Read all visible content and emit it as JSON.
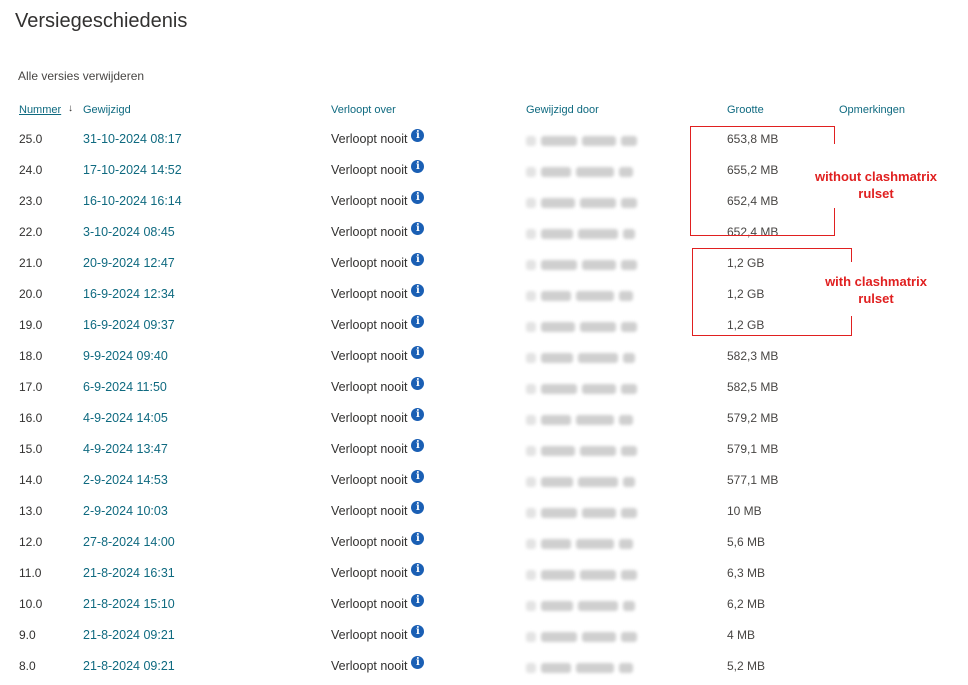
{
  "page": {
    "title": "Versiegeschiedenis",
    "delete_all": "Alle versies verwijderen"
  },
  "columns": {
    "number": "Nummer",
    "sort_indicator": "↓",
    "modified": "Gewijzigd",
    "expires": "Verloopt over",
    "modified_by": "Gewijzigd door",
    "size": "Grootte",
    "comments": "Opmerkingen"
  },
  "rows": [
    {
      "number": "25.0",
      "modified": "31-10-2024 08:17",
      "expires": "Verloopt nooit",
      "size": "653,8 MB"
    },
    {
      "number": "24.0",
      "modified": "17-10-2024 14:52",
      "expires": "Verloopt nooit",
      "size": "655,2 MB"
    },
    {
      "number": "23.0",
      "modified": "16-10-2024 16:14",
      "expires": "Verloopt nooit",
      "size": "652,4 MB"
    },
    {
      "number": "22.0",
      "modified": "3-10-2024 08:45",
      "expires": "Verloopt nooit",
      "size": "652,4 MB"
    },
    {
      "number": "21.0",
      "modified": "20-9-2024 12:47",
      "expires": "Verloopt nooit",
      "size": "1,2 GB"
    },
    {
      "number": "20.0",
      "modified": "16-9-2024 12:34",
      "expires": "Verloopt nooit",
      "size": "1,2 GB"
    },
    {
      "number": "19.0",
      "modified": "16-9-2024 09:37",
      "expires": "Verloopt nooit",
      "size": "1,2 GB"
    },
    {
      "number": "18.0",
      "modified": "9-9-2024 09:40",
      "expires": "Verloopt nooit",
      "size": "582,3 MB"
    },
    {
      "number": "17.0",
      "modified": "6-9-2024 11:50",
      "expires": "Verloopt nooit",
      "size": "582,5 MB"
    },
    {
      "number": "16.0",
      "modified": "4-9-2024 14:05",
      "expires": "Verloopt nooit",
      "size": "579,2 MB"
    },
    {
      "number": "15.0",
      "modified": "4-9-2024 13:47",
      "expires": "Verloopt nooit",
      "size": "579,1 MB"
    },
    {
      "number": "14.0",
      "modified": "2-9-2024 14:53",
      "expires": "Verloopt nooit",
      "size": "577,1 MB"
    },
    {
      "number": "13.0",
      "modified": "2-9-2024 10:03",
      "expires": "Verloopt nooit",
      "size": "10 MB"
    },
    {
      "number": "12.0",
      "modified": "27-8-2024 14:00",
      "expires": "Verloopt nooit",
      "size": "5,6 MB"
    },
    {
      "number": "11.0",
      "modified": "21-8-2024 16:31",
      "expires": "Verloopt nooit",
      "size": "6,3 MB"
    },
    {
      "number": "10.0",
      "modified": "21-8-2024 15:10",
      "expires": "Verloopt nooit",
      "size": "6,2 MB"
    },
    {
      "number": "9.0",
      "modified": "21-8-2024 09:21",
      "expires": "Verloopt nooit",
      "size": "4 MB"
    },
    {
      "number": "8.0",
      "modified": "21-8-2024 09:21",
      "expires": "Verloopt nooit",
      "size": "5,2 MB"
    }
  ],
  "icons": {
    "info": "info-icon",
    "info_glyph": "i",
    "info_color": "#1a5fb4"
  },
  "annotations": {
    "color": "#e02020",
    "box1_label": "without clashmatrix\nrulset",
    "box2_label": "with clashmatrix\nrulset"
  },
  "colors": {
    "link": "#0f6a80",
    "text": "#323130"
  }
}
